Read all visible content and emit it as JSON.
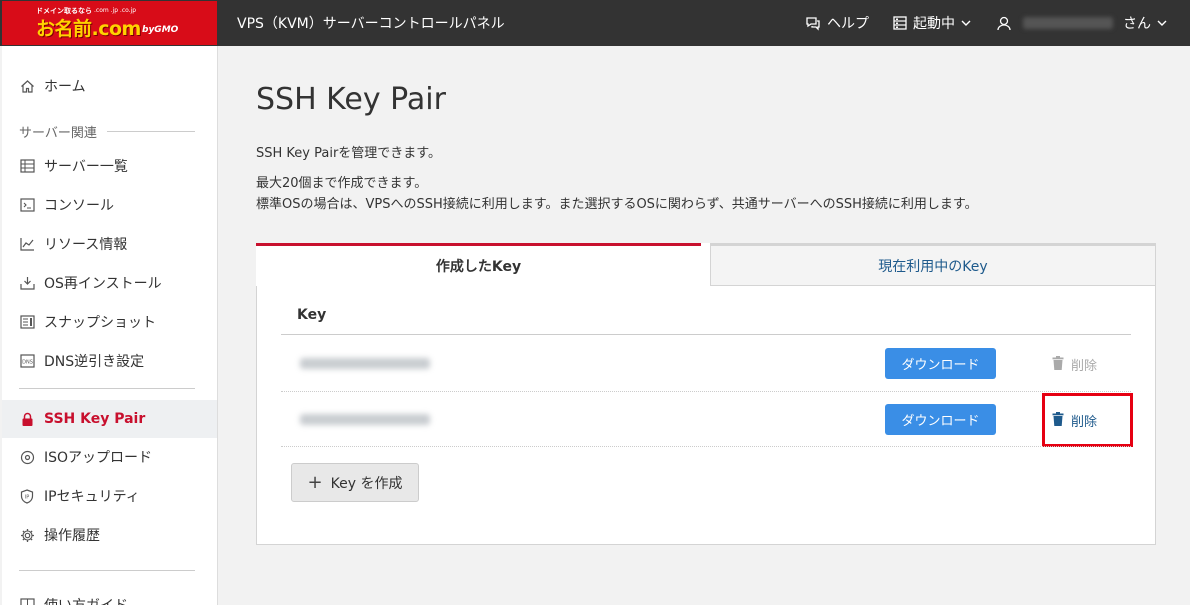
{
  "header": {
    "logo": {
      "tagline": "ドメイン取るなら",
      "tlds": ".com .jp .co.jp",
      "name": "お名前.com",
      "by": "byGMO"
    },
    "title": "VPS（KVM）サーバーコントロールパネル",
    "help_label": "ヘルプ",
    "status_label": "起動中",
    "user_suffix": "さん"
  },
  "sidebar": {
    "home": "ホーム",
    "section_label": "サーバー関連",
    "items": [
      {
        "label": "サーバー一覧",
        "icon": "server-list-icon"
      },
      {
        "label": "コンソール",
        "icon": "console-icon"
      },
      {
        "label": "リソース情報",
        "icon": "chart-icon"
      },
      {
        "label": "OS再インストール",
        "icon": "download-icon"
      },
      {
        "label": "スナップショット",
        "icon": "snapshot-icon"
      },
      {
        "label": "DNS逆引き設定",
        "icon": "dns-icon"
      }
    ],
    "active_item": "SSH Key Pair",
    "items2": [
      {
        "label": "ISOアップロード",
        "icon": "disc-icon"
      },
      {
        "label": "IPセキュリティ",
        "icon": "shield-icon"
      },
      {
        "label": "操作履歴",
        "icon": "gear-icon"
      }
    ],
    "bottom_partial": "使い方ガイド"
  },
  "main": {
    "title": "SSH Key Pair",
    "desc1": "SSH Key Pairを管理できます。",
    "desc2": "最大20個まで作成できます。",
    "desc3": "標準OSの場合は、VPSへのSSH接続に利用します。また選択するOSに関わらず、共通サーバーへのSSH接続に利用します。",
    "tabs": [
      "作成したKey",
      "現在利用中のKey"
    ],
    "column_key": "Key",
    "rows": [
      {
        "download": "ダウンロード",
        "delete": "削除",
        "delete_enabled": false
      },
      {
        "download": "ダウンロード",
        "delete": "削除",
        "delete_enabled": true
      }
    ],
    "create_button": "Key を作成"
  },
  "colors": {
    "brand_red": "#d80c18",
    "accent_blue": "#3a8ee6",
    "header_bg": "#333333",
    "highlight_red": "#e60012"
  }
}
